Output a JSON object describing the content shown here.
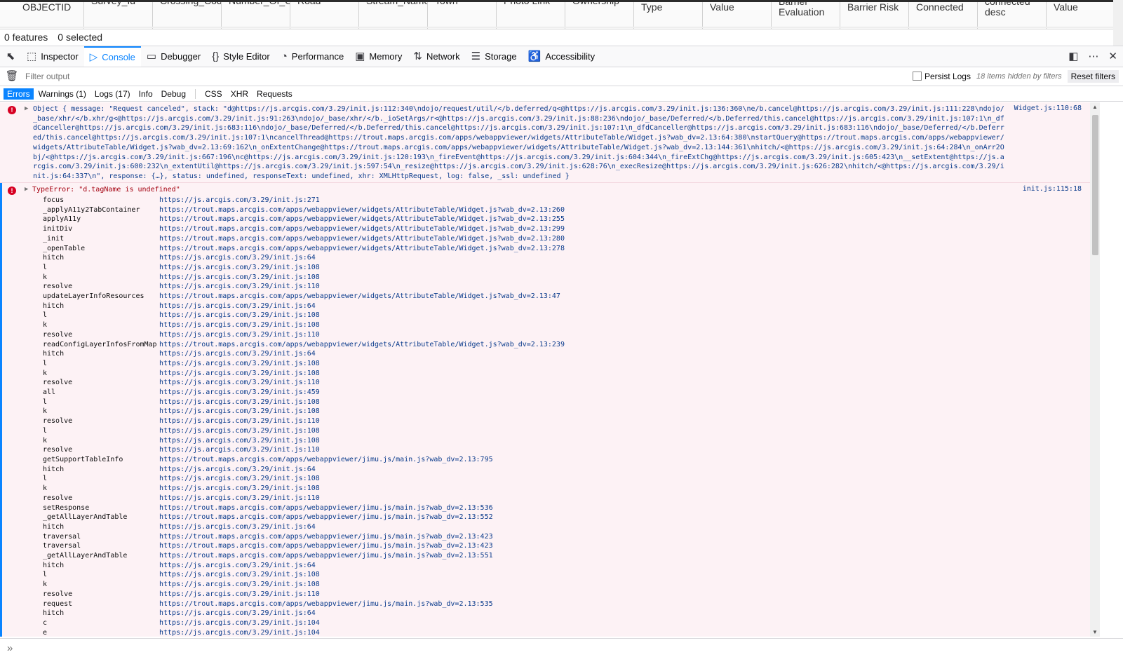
{
  "attr_table": {
    "columns": [
      "OBJECTID",
      "Survey_Id",
      "Crossing_Cod",
      "Number_Of_C",
      "Road",
      "Stream_Name",
      "Town",
      "Photo Link",
      "Ownership",
      "Type",
      "Value",
      "Barrier Evaluation",
      "Barrier Risk",
      "Connected",
      "connected desc",
      "Value"
    ],
    "features_text": "0 features",
    "selected_text": "0 selected"
  },
  "devtools": {
    "tabs": [
      {
        "label": "Inspector",
        "icon": "inspector-icon",
        "glyph": "⬚"
      },
      {
        "label": "Console",
        "icon": "console-icon",
        "glyph": "▷"
      },
      {
        "label": "Debugger",
        "icon": "debugger-icon",
        "glyph": "▭"
      },
      {
        "label": "Style Editor",
        "icon": "style-editor-icon",
        "glyph": "{}"
      },
      {
        "label": "Performance",
        "icon": "performance-icon",
        "glyph": "◔"
      },
      {
        "label": "Memory",
        "icon": "memory-icon",
        "glyph": "▣"
      },
      {
        "label": "Network",
        "icon": "network-icon",
        "glyph": "⇅"
      },
      {
        "label": "Storage",
        "icon": "storage-icon",
        "glyph": "☰"
      },
      {
        "label": "Accessibility",
        "icon": "accessibility-icon",
        "glyph": "♿"
      }
    ],
    "active_tab": "Console",
    "accent": "#0a84ff"
  },
  "filter": {
    "placeholder": "Filter output",
    "persist_logs": "Persist Logs",
    "hidden_text": "18 items hidden by filters",
    "reset": "Reset filters"
  },
  "categories": [
    "Errors",
    "Warnings (1)",
    "Logs (17)",
    "Info",
    "Debug",
    "CSS",
    "XHR",
    "Requests"
  ],
  "messages": [
    {
      "text": "Object { message: \"Request canceled\", stack: \"d@https://js.arcgis.com/3.29/init.js:112:340\\ndojo/request/util/</b.deferred/q<@https://js.arcgis.com/3.29/init.js:136:360\\ne/b.cancel@https://js.arcgis.com/3.29/init.js:111:228\\ndojo/_base/xhr/</b.xhr/g<@https://js.arcgis.com/3.29/init.js:91:263\\ndojo/_base/xhr/</b._ioSetArgs/r<@https://js.arcgis.com/3.29/init.js:88:236\\ndojo/_base/Deferred/</b.Deferred/this.cancel@https://js.arcgis.com/3.29/init.js:107:1\\n_dfdCanceller@https://js.arcgis.com/3.29/init.js:683:116\\ndojo/_base/Deferred/</b.Deferred/this.cancel@https://js.arcgis.com/3.29/init.js:107:1\\n_dfdCanceller@https://js.arcgis.com/3.29/init.js:683:116\\ndojo/_base/Deferred/</b.Deferred/this.cancel@https://js.arcgis.com/3.29/init.js:107:1\\ncancelThread@https://trout.maps.arcgis.com/apps/webappviewer/widgets/AttributeTable/Widget.js?wab_dv=2.13:64:380\\nstartQuery@https://trout.maps.arcgis.com/apps/webappviewer/widgets/AttributeTable/Widget.js?wab_dv=2.13:69:162\\n_onExtentChange@https://trout.maps.arcgis.com/apps/webappviewer/widgets/AttributeTable/Widget.js?wab_dv=2.13:144:361\\nhitch/<@https://js.arcgis.com/3.29/init.js:64:284\\n_onArr2Obj/<@https://js.arcgis.com/3.29/init.js:667:196\\nc@https://js.arcgis.com/3.29/init.js:120:193\\n_fireEvent@https://js.arcgis.com/3.29/init.js:604:344\\n_fireExtChg@https://js.arcgis.com/3.29/init.js:605:423\\n__setExtent@https://js.arcgis.com/3.29/init.js:600:232\\n_extentUtil@https://js.arcgis.com/3.29/init.js:597:54\\n_resize@https://js.arcgis.com/3.29/init.js:628:76\\n_execResize@https://js.arcgis.com/3.29/init.js:626:282\\nhitch/<@https://js.arcgis.com/3.29/init.js:64:337\\n\", response: {…}, status: undefined, responseText: undefined, xhr: XMLHttpRequest, log: false, _ssl: undefined }",
      "source": "Widget.js:110:68"
    },
    {
      "text": "TypeError: \"d.tagName is undefined\"",
      "source": "init.js:115:18",
      "trace": [
        {
          "fn": "focus",
          "loc": "https://js.arcgis.com/3.29/init.js:271"
        },
        {
          "fn": "_applyA11y2TabContainer",
          "loc": "https://trout.maps.arcgis.com/apps/webappviewer/widgets/AttributeTable/Widget.js?wab_dv=2.13:260"
        },
        {
          "fn": "applyA11y",
          "loc": "https://trout.maps.arcgis.com/apps/webappviewer/widgets/AttributeTable/Widget.js?wab_dv=2.13:255"
        },
        {
          "fn": "initDiv",
          "loc": "https://trout.maps.arcgis.com/apps/webappviewer/widgets/AttributeTable/Widget.js?wab_dv=2.13:299"
        },
        {
          "fn": "_init",
          "loc": "https://trout.maps.arcgis.com/apps/webappviewer/widgets/AttributeTable/Widget.js?wab_dv=2.13:280"
        },
        {
          "fn": "_openTable",
          "loc": "https://trout.maps.arcgis.com/apps/webappviewer/widgets/AttributeTable/Widget.js?wab_dv=2.13:278"
        },
        {
          "fn": "hitch",
          "loc": "https://js.arcgis.com/3.29/init.js:64"
        },
        {
          "fn": "l",
          "loc": "https://js.arcgis.com/3.29/init.js:108"
        },
        {
          "fn": "k",
          "loc": "https://js.arcgis.com/3.29/init.js:108"
        },
        {
          "fn": "resolve",
          "loc": "https://js.arcgis.com/3.29/init.js:110"
        },
        {
          "fn": "updateLayerInfoResources",
          "loc": "https://trout.maps.arcgis.com/apps/webappviewer/widgets/AttributeTable/Widget.js?wab_dv=2.13:47"
        },
        {
          "fn": "hitch",
          "loc": "https://js.arcgis.com/3.29/init.js:64"
        },
        {
          "fn": "l",
          "loc": "https://js.arcgis.com/3.29/init.js:108"
        },
        {
          "fn": "k",
          "loc": "https://js.arcgis.com/3.29/init.js:108"
        },
        {
          "fn": "resolve",
          "loc": "https://js.arcgis.com/3.29/init.js:110"
        },
        {
          "fn": "readConfigLayerInfosFromMap",
          "loc": "https://trout.maps.arcgis.com/apps/webappviewer/widgets/AttributeTable/Widget.js?wab_dv=2.13:239"
        },
        {
          "fn": "hitch",
          "loc": "https://js.arcgis.com/3.29/init.js:64"
        },
        {
          "fn": "l",
          "loc": "https://js.arcgis.com/3.29/init.js:108"
        },
        {
          "fn": "k",
          "loc": "https://js.arcgis.com/3.29/init.js:108"
        },
        {
          "fn": "resolve",
          "loc": "https://js.arcgis.com/3.29/init.js:110"
        },
        {
          "fn": "all",
          "loc": "https://js.arcgis.com/3.29/init.js:459"
        },
        {
          "fn": "l",
          "loc": "https://js.arcgis.com/3.29/init.js:108"
        },
        {
          "fn": "k",
          "loc": "https://js.arcgis.com/3.29/init.js:108"
        },
        {
          "fn": "resolve",
          "loc": "https://js.arcgis.com/3.29/init.js:110"
        },
        {
          "fn": "l",
          "loc": "https://js.arcgis.com/3.29/init.js:108"
        },
        {
          "fn": "k",
          "loc": "https://js.arcgis.com/3.29/init.js:108"
        },
        {
          "fn": "resolve",
          "loc": "https://js.arcgis.com/3.29/init.js:110"
        },
        {
          "fn": "getSupportTableInfo",
          "loc": "https://trout.maps.arcgis.com/apps/webappviewer/jimu.js/main.js?wab_dv=2.13:795"
        },
        {
          "fn": "hitch",
          "loc": "https://js.arcgis.com/3.29/init.js:64"
        },
        {
          "fn": "l",
          "loc": "https://js.arcgis.com/3.29/init.js:108"
        },
        {
          "fn": "k",
          "loc": "https://js.arcgis.com/3.29/init.js:108"
        },
        {
          "fn": "resolve",
          "loc": "https://js.arcgis.com/3.29/init.js:110"
        },
        {
          "fn": "setResponse",
          "loc": "https://trout.maps.arcgis.com/apps/webappviewer/jimu.js/main.js?wab_dv=2.13:536"
        },
        {
          "fn": "_getAllLayerAndTable",
          "loc": "https://trout.maps.arcgis.com/apps/webappviewer/jimu.js/main.js?wab_dv=2.13:552"
        },
        {
          "fn": "hitch",
          "loc": "https://js.arcgis.com/3.29/init.js:64"
        },
        {
          "fn": "traversal",
          "loc": "https://trout.maps.arcgis.com/apps/webappviewer/jimu.js/main.js?wab_dv=2.13:423"
        },
        {
          "fn": "traversal",
          "loc": "https://trout.maps.arcgis.com/apps/webappviewer/jimu.js/main.js?wab_dv=2.13:423"
        },
        {
          "fn": "_getAllLayerAndTable",
          "loc": "https://trout.maps.arcgis.com/apps/webappviewer/jimu.js/main.js?wab_dv=2.13:551"
        },
        {
          "fn": "hitch",
          "loc": "https://js.arcgis.com/3.29/init.js:64"
        },
        {
          "fn": "l",
          "loc": "https://js.arcgis.com/3.29/init.js:108"
        },
        {
          "fn": "k",
          "loc": "https://js.arcgis.com/3.29/init.js:108"
        },
        {
          "fn": "resolve",
          "loc": "https://js.arcgis.com/3.29/init.js:110"
        },
        {
          "fn": "request",
          "loc": "https://trout.maps.arcgis.com/apps/webappviewer/jimu.js/main.js?wab_dv=2.13:535"
        },
        {
          "fn": "hitch",
          "loc": "https://js.arcgis.com/3.29/init.js:64"
        },
        {
          "fn": "c",
          "loc": "https://js.arcgis.com/3.29/init.js:104"
        },
        {
          "fn": "e",
          "loc": "https://js.arcgis.com/3.29/init.js:104"
        }
      ]
    }
  ],
  "prompt_glyph": "»"
}
